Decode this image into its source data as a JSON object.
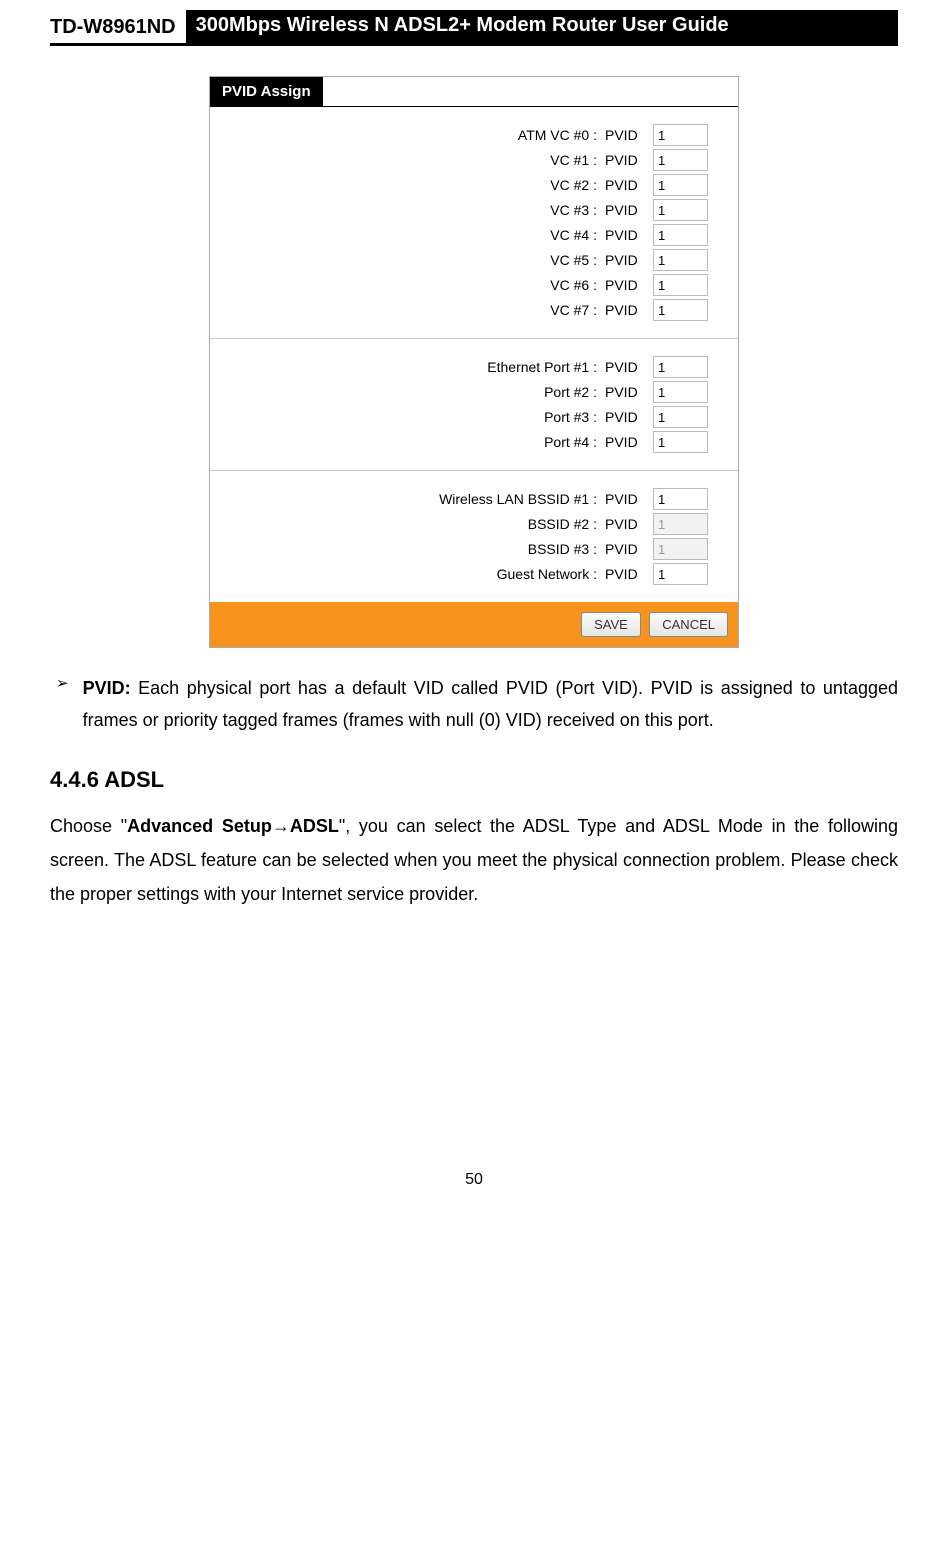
{
  "header": {
    "model": "TD-W8961ND",
    "title": "300Mbps Wireless N ADSL2+ Modem Router User Guide"
  },
  "figure": {
    "panel_title": "PVID Assign",
    "pvid_word": "PVID",
    "groups": [
      {
        "rows": [
          {
            "label": "ATM VC #0  :",
            "value": "1",
            "enabled": true
          },
          {
            "label": "VC #1  :",
            "value": "1",
            "enabled": true
          },
          {
            "label": "VC #2  :",
            "value": "1",
            "enabled": true
          },
          {
            "label": "VC #3  :",
            "value": "1",
            "enabled": true
          },
          {
            "label": "VC #4  :",
            "value": "1",
            "enabled": true
          },
          {
            "label": "VC #5  :",
            "value": "1",
            "enabled": true
          },
          {
            "label": "VC #6  :",
            "value": "1",
            "enabled": true
          },
          {
            "label": "VC #7  :",
            "value": "1",
            "enabled": true
          }
        ]
      },
      {
        "rows": [
          {
            "label": "Ethernet Port #1  :",
            "value": "1",
            "enabled": true
          },
          {
            "label": "Port #2  :",
            "value": "1",
            "enabled": true
          },
          {
            "label": "Port #3  :",
            "value": "1",
            "enabled": true
          },
          {
            "label": "Port #4  :",
            "value": "1",
            "enabled": true
          }
        ]
      },
      {
        "rows": [
          {
            "label": "Wireless LAN BSSID #1  :",
            "value": "1",
            "enabled": true
          },
          {
            "label": "BSSID #2  :",
            "value": "1",
            "enabled": false
          },
          {
            "label": "BSSID #3  :",
            "value": "1",
            "enabled": false
          },
          {
            "label": "Guest Network  :",
            "value": "1",
            "enabled": true
          }
        ]
      }
    ],
    "buttons": {
      "save": "SAVE",
      "cancel": "CANCEL"
    }
  },
  "bullet": {
    "marker": "➢",
    "bold": "PVID:",
    "text": " Each physical port has a default VID called PVID (Port VID). PVID is assigned to untagged frames or priority tagged frames (frames with null (0) VID) received on this port."
  },
  "section": {
    "heading": "4.4.6   ADSL",
    "para_pre": "Choose \"",
    "para_bold1": "Advanced Setup",
    "para_arrow": "→",
    "para_bold2": "ADSL",
    "para_post": "\", you can select the ADSL Type and ADSL Mode in the following screen. The ADSL feature can be selected when you meet the physical connection problem. Please check the proper settings with your Internet service provider."
  },
  "page_number": "50"
}
